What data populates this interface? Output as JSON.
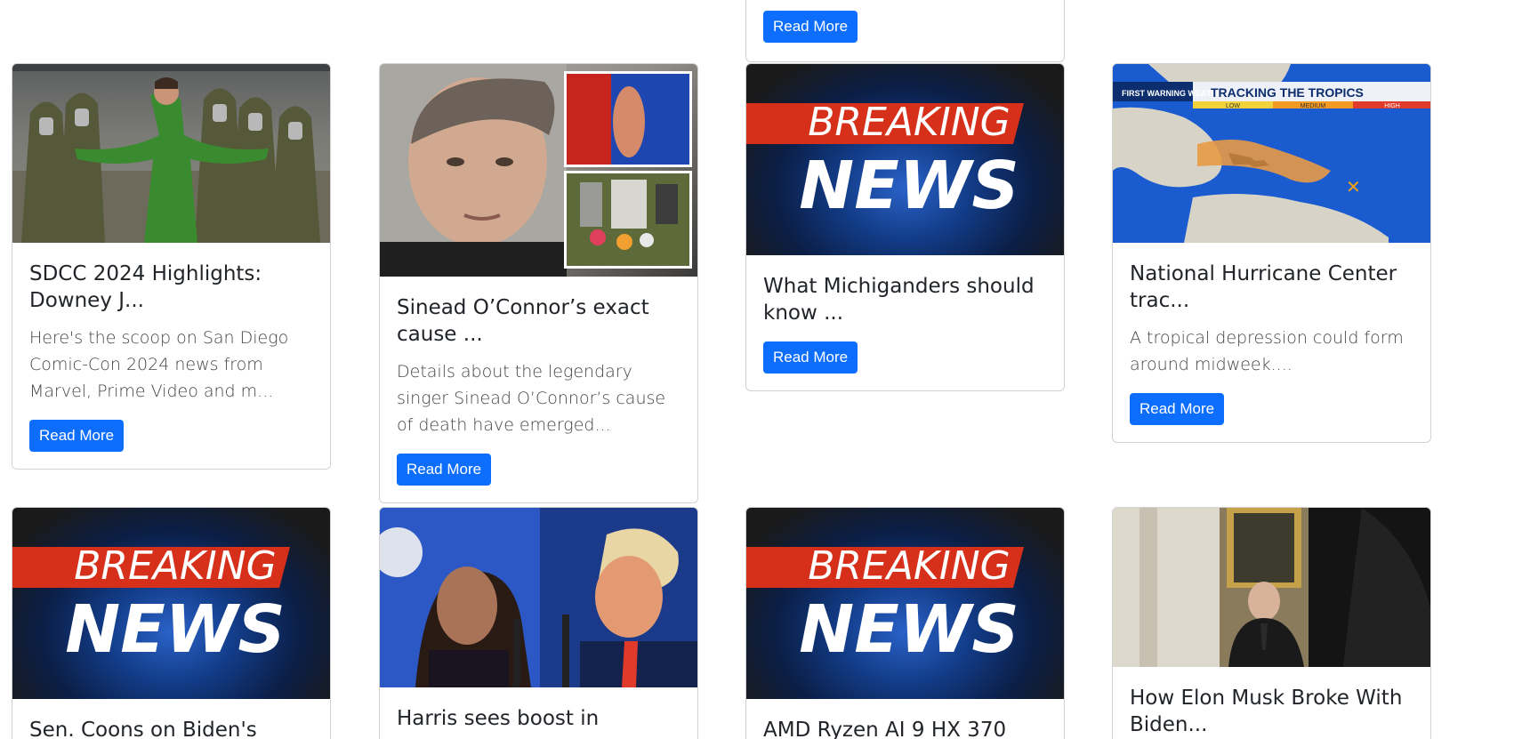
{
  "read_more_label": "Read More",
  "cards": [
    {
      "title": "SDCC 2024 Highlights: Downey J...",
      "text": "Here's the scoop on San Diego Comic-Con 2024 news from Marvel, Prime Video and m...",
      "image": "comic-con-photo"
    },
    {
      "title": "Sinead O’Connor’s exact cause ...",
      "text": "Details about the legendary singer Sinead O’Connor’s cause of death have emerged...",
      "image": "sinead-collage"
    },
    {
      "title": "What Michiganders should know ...",
      "text": "",
      "image": "breaking-news"
    },
    {
      "title": "National Hurricane Center trac...",
      "text": "A tropical depression could form around midweek....",
      "image": "hurricane-map",
      "map_labels": {
        "station": "FIRST WARNING WEATHER",
        "banner": "TRACKING THE TROPICS",
        "low": "LOW",
        "medium": "MEDIUM",
        "high": "HIGH"
      }
    },
    {
      "title": "Sen. Coons on Biden's",
      "image": "breaking-news"
    },
    {
      "title": "Harris sees boost in",
      "image": "harris-trump"
    },
    {
      "title": "AMD Ryzen AI 9 HX 370",
      "image": "breaking-news"
    },
    {
      "title": "How Elon Musk Broke With Biden...",
      "image": "musk-photo"
    }
  ],
  "breaking_news": {
    "line1": "BREAKING",
    "line2": "NEWS"
  },
  "colors": {
    "button": "#0d6efd",
    "breaking_red": "#d6301a",
    "map_blue": "#1a5bd0"
  }
}
